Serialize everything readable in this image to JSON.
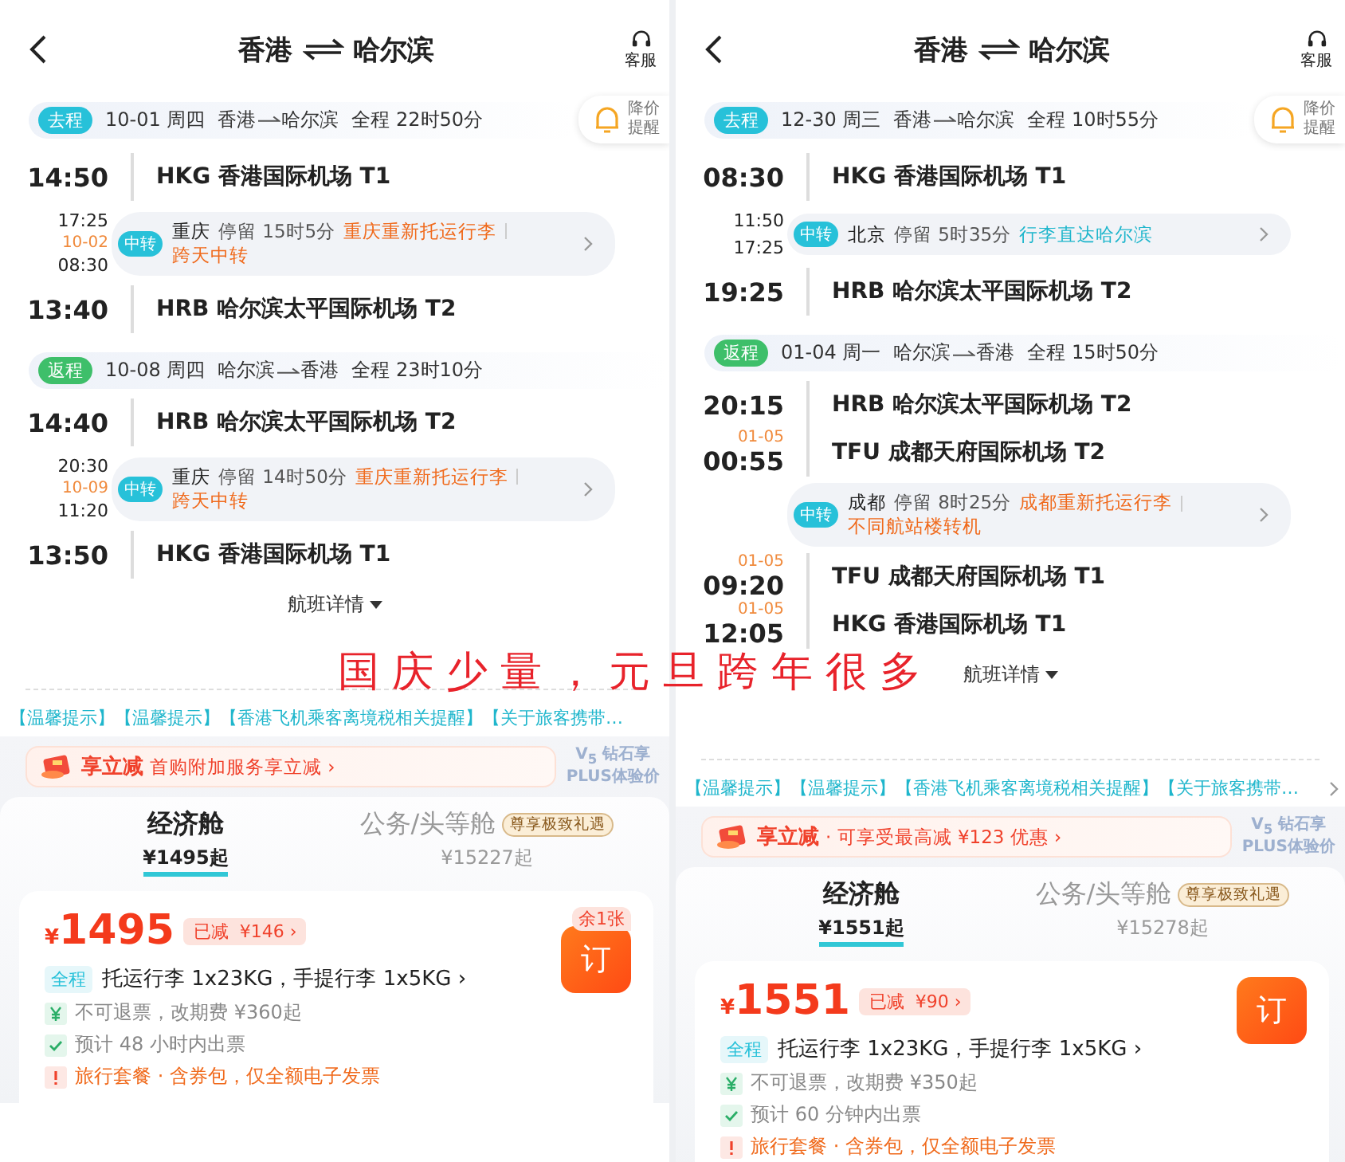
{
  "panels": [
    {
      "title_from": "香港",
      "title_to": "哈尔滨",
      "service": "客服",
      "price_alert": "降价提醒",
      "legs": [
        {
          "tag": "去程",
          "kind": "outbound",
          "date": "10-01 周四",
          "from": "香港",
          "to": "哈尔滨",
          "duration": "全程 22时50分",
          "stops": [
            {
              "kind": "airport",
              "time": "14:50",
              "name": "HKG 香港国际机场 T1"
            },
            {
              "kind": "transfer",
              "arrive": "17:25",
              "depart_date": "10-02",
              "depart": "08:30",
              "tag": "中转",
              "city": "重庆",
              "stay": "停留 15时5分",
              "notes": [
                {
                  "text": "重庆重新托运行李",
                  "color": "#f06a1c"
                },
                {
                  "text": "跨天中转",
                  "color": "#f06a1c"
                }
              ]
            },
            {
              "kind": "airport",
              "time": "13:40",
              "name": "HRB 哈尔滨太平国际机场 T2"
            }
          ]
        },
        {
          "tag": "返程",
          "kind": "return",
          "date": "10-08 周四",
          "from": "哈尔滨",
          "to": "香港",
          "duration": "全程 23时10分",
          "stops": [
            {
              "kind": "airport",
              "time": "14:40",
              "name": "HRB 哈尔滨太平国际机场 T2"
            },
            {
              "kind": "transfer",
              "arrive": "20:30",
              "depart_date": "10-09",
              "depart": "11:20",
              "tag": "中转",
              "city": "重庆",
              "stay": "停留 14时50分",
              "notes": [
                {
                  "text": "重庆重新托运行李",
                  "color": "#f06a1c"
                },
                {
                  "text": "跨天中转",
                  "color": "#f06a1c"
                }
              ]
            },
            {
              "kind": "airport",
              "time": "13:50",
              "name": "HKG 香港国际机场 T1"
            }
          ]
        }
      ],
      "details_link": "航班详情",
      "notice": "【温馨提示】【温馨提示】【香港飞机乘客离境税相关提醒】【关于旅客携带…",
      "notice_arrow": false,
      "promo": {
        "title": "享立减",
        "text": "首购附加服务享立减 ›"
      },
      "plus": {
        "level": "V$_{5}$",
        "name": "钻石享",
        "sub": "PLUS体验价"
      },
      "cabins": [
        {
          "name": "经济舱",
          "price": "¥1495起",
          "selected": true
        },
        {
          "name": "公务/头等舱",
          "price": "¥15227起",
          "selected": false,
          "badge": "尊享极致礼遇"
        }
      ],
      "fare": {
        "currency": "¥",
        "price": "1495",
        "discount_label": "已减",
        "discount": "¥146 ›",
        "stock": "余1张",
        "book": "订",
        "baggage_tag": "全程",
        "baggage": "托运行李 1x23KG，手提行李 1x5KG ›",
        "conditions": [
          {
            "kind": "refund",
            "text": "不可退票，改期费 ¥360起"
          },
          {
            "kind": "ticketing",
            "text": "预计 48 小时内出票"
          },
          {
            "kind": "package",
            "text": "旅行套餐 · 含券包，仅全额电子发票"
          }
        ]
      },
      "cut_bottom": true
    },
    {
      "title_from": "香港",
      "title_to": "哈尔滨",
      "service": "客服",
      "price_alert": "降价提醒",
      "legs": [
        {
          "tag": "去程",
          "kind": "outbound",
          "date": "12-30 周三",
          "from": "香港",
          "to": "哈尔滨",
          "duration": "全程 10时55分",
          "stops": [
            {
              "kind": "airport",
              "time": "08:30",
              "name": "HKG 香港国际机场 T1"
            },
            {
              "kind": "transfer",
              "arrive": "11:50",
              "depart": "17:25",
              "tag": "中转",
              "city": "北京",
              "stay": "停留 5时35分",
              "notes": [
                {
                  "text": "行李直达哈尔滨",
                  "color": "#1fb6cc"
                }
              ]
            },
            {
              "kind": "airport",
              "time": "19:25",
              "name": "HRB 哈尔滨太平国际机场 T2"
            }
          ]
        },
        {
          "tag": "返程",
          "kind": "return",
          "date": "01-04 周一",
          "from": "哈尔滨",
          "to": "香港",
          "duration": "全程 15时50分",
          "stops": [
            {
              "kind": "airport",
              "time": "20:15",
              "name": "HRB 哈尔滨太平国际机场 T2"
            },
            {
              "kind": "airport",
              "date": "01-05",
              "time": "00:55",
              "name": "TFU 成都天府国际机场 T2"
            },
            {
              "kind": "transfer",
              "tag": "中转",
              "city": "成都",
              "stay": "停留 8时25分",
              "notes": [
                {
                  "text": "成都重新托运行李",
                  "color": "#f06a1c"
                },
                {
                  "text": "不同航站楼转机",
                  "color": "#f06a1c"
                }
              ]
            },
            {
              "kind": "airport",
              "date": "01-05",
              "time": "09:20",
              "name": "TFU 成都天府国际机场 T1"
            },
            {
              "kind": "airport",
              "date": "01-05",
              "time": "12:05",
              "name": "HKG 香港国际机场 T1"
            }
          ]
        }
      ],
      "details_link": "航班详情",
      "notice": "【温馨提示】【温馨提示】【香港飞机乘客离境税相关提醒】【关于旅客携带…",
      "notice_arrow": true,
      "promo": {
        "title": "享立减",
        "text": "· 可享受最高减 ¥123 优惠 ›"
      },
      "plus": {
        "level": "V$_{5}$",
        "name": "钻石享",
        "sub": "PLUS体验价"
      },
      "cabins": [
        {
          "name": "经济舱",
          "price": "¥1551起",
          "selected": true
        },
        {
          "name": "公务/头等舱",
          "price": "¥15278起",
          "selected": false,
          "badge": "尊享极致礼遇"
        }
      ],
      "fare": {
        "currency": "¥",
        "price": "1551",
        "discount_label": "已减",
        "discount": "¥90 ›",
        "book": "订",
        "baggage_tag": "全程",
        "baggage": "托运行李 1x23KG，手提行李 1x5KG ›",
        "conditions": [
          {
            "kind": "refund",
            "text": "不可退票，改期费 ¥350起"
          },
          {
            "kind": "ticketing",
            "text": "预计 60 分钟内出票"
          },
          {
            "kind": "package",
            "text": "旅行套餐 · 含券包，仅全额电子发票"
          }
        ]
      },
      "cut_bottom": false
    }
  ],
  "annotation": "国庆少量，元旦跨年很多"
}
